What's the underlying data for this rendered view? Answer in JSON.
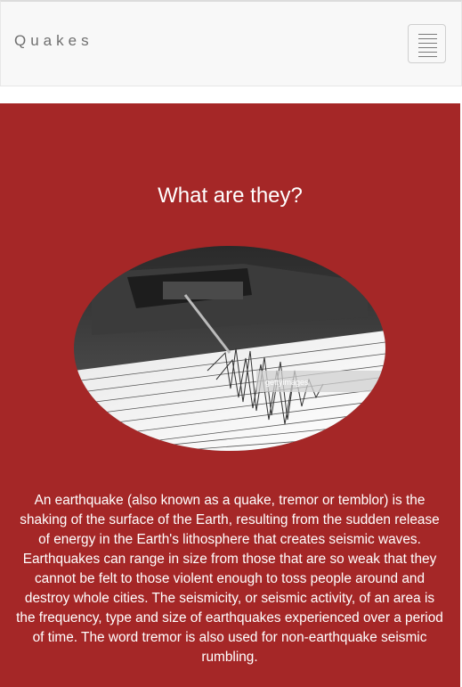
{
  "navbar": {
    "brand": "Quakes",
    "menu_icon": "hamburger-menu-icon"
  },
  "hero": {
    "title": "What are they?",
    "image": {
      "subject": "seismograph recording an earthquake",
      "watermark": "gettyimages"
    },
    "body": "An earthquake (also known as a quake, tremor or temblor) is the shaking of the surface of the Earth, resulting from the sudden release of energy in the Earth's lithosphere that creates seismic waves. Earthquakes can range in size from those that are so weak that they cannot be felt to those violent enough to toss people around and destroy whole cities. The seismicity, or seismic activity, of an area is the frequency, type and size of earthquakes experienced over a period of time. The word tremor is also used for non-earthquake seismic rumbling."
  },
  "colors": {
    "hero_background": "#a52727",
    "navbar_background": "#f8f8f8",
    "brand_text": "#6f6f6f"
  }
}
